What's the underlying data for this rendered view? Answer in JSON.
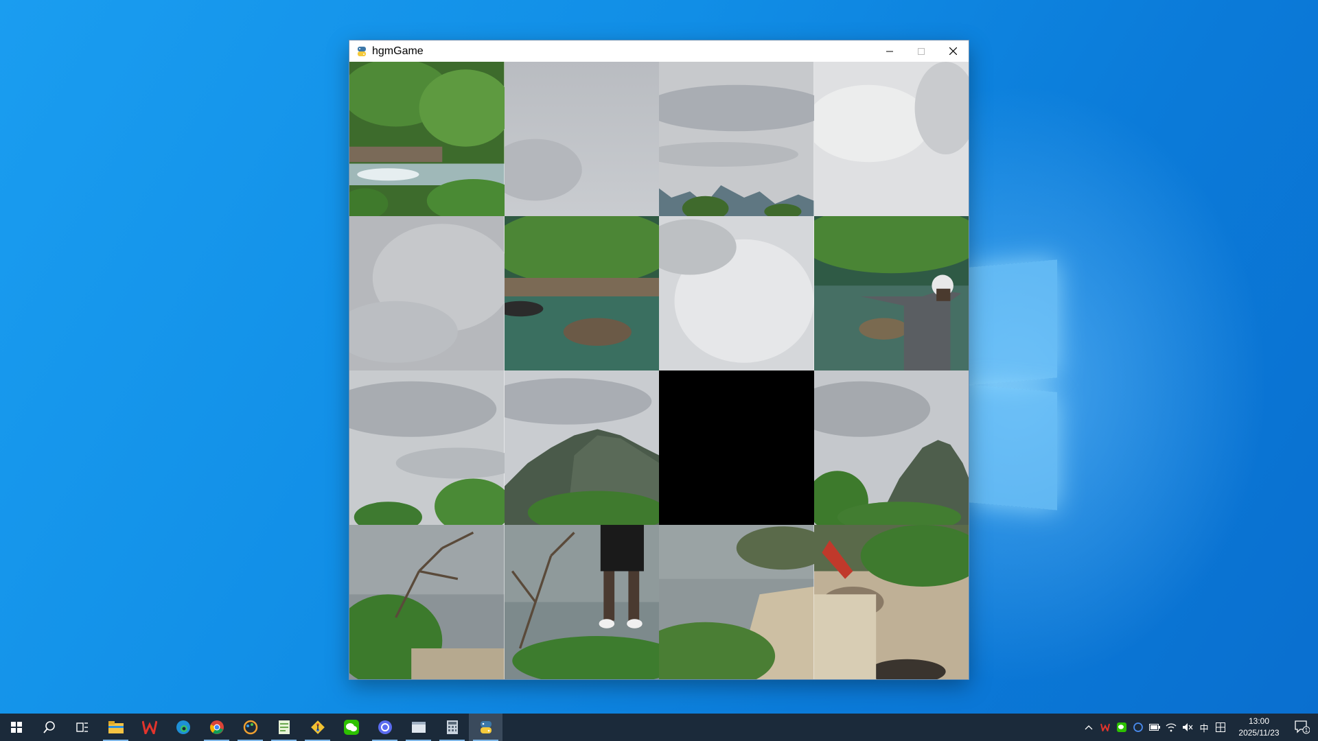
{
  "window": {
    "title": "hgmGame",
    "icon": "python-icon",
    "controls": [
      "minimize-icon",
      "maximize-icon",
      "close-icon"
    ]
  },
  "board": {
    "rows": 4,
    "cols": 4,
    "empty_tile": "row 3, column 3",
    "tiles": [
      "green-bushes-rapids",
      "grey-sky",
      "sky-distant-hills",
      "bright-sky",
      "grey-sky",
      "river-rocks-bushes",
      "bright-sky",
      "cyclist-arms-outstretched",
      "sky-trees",
      "karst-peak",
      "empty",
      "karst-peak-right",
      "shore-dead-branches",
      "person-legs-on-shore",
      "riverbank-sand",
      "rocky-shore-red-object"
    ]
  },
  "taskbar": {
    "pinned_apps": [
      "start-icon",
      "search-icon",
      "task-view-icon",
      "file-explorer-icon",
      "wps-icon",
      "edge-icon",
      "chrome-icon",
      "paint-icon",
      "notepad-icon",
      "git-icon",
      "wechat-icon",
      "app-circle-icon",
      "window-icon",
      "calculator-icon",
      "python-icon"
    ],
    "tray": {
      "ime": "中",
      "time": "13:00",
      "date": "2025/11/23",
      "notification_count": "1"
    }
  },
  "colors": {
    "desktop": "#118ee6",
    "taskbar": "#1b2a3a",
    "empty_tile": "#000000"
  }
}
